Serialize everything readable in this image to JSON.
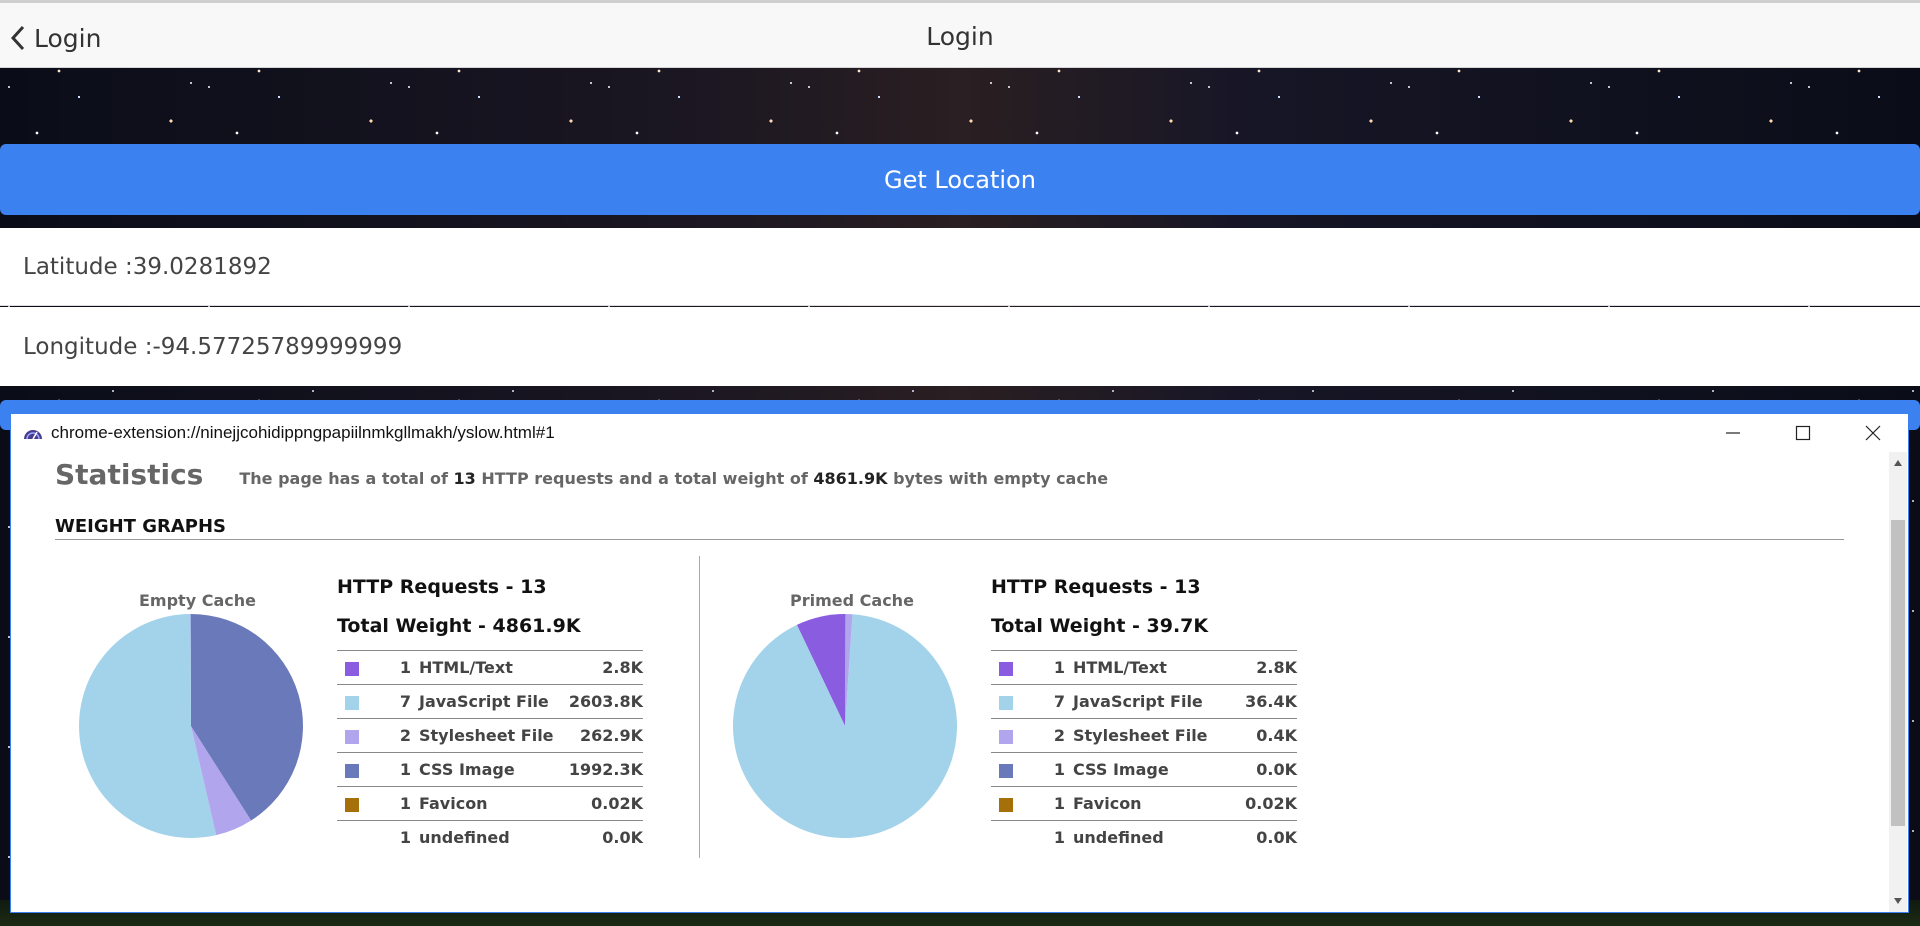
{
  "header": {
    "back_label": "Login",
    "title": "Login"
  },
  "location": {
    "button_label": "Get Location",
    "latitude": "Latitude :39.0281892",
    "longitude": "Longitude :-94.57725789999999"
  },
  "popup": {
    "url": "chrome-extension://ninejjcohidippngpapiilnmkgllmakh/yslow.html#1",
    "statistics": {
      "title": "Statistics",
      "text_1": "The page has a total of",
      "requests": "13",
      "text_2": "HTTP requests and a total weight of",
      "weight": "4861.9K",
      "text_3": "bytes with empty cache"
    },
    "weight_graphs_title": "WEIGHT GRAPHS",
    "empty_cache": {
      "caption": "Empty Cache",
      "requests_label": "HTTP Requests - 13",
      "weight_label": "Total Weight - 4861.9K",
      "rows": [
        {
          "count": "1",
          "label": "HTML/Text",
          "value": "2.8K",
          "color": "#8a5ce0"
        },
        {
          "count": "7",
          "label": "JavaScript File",
          "value": "2603.8K",
          "color": "#a3d3ea"
        },
        {
          "count": "2",
          "label": "Stylesheet File",
          "value": "262.9K",
          "color": "#b1a5ee"
        },
        {
          "count": "1",
          "label": "CSS Image",
          "value": "1992.3K",
          "color": "#6a79b9"
        },
        {
          "count": "1",
          "label": "Favicon",
          "value": "0.02K",
          "color": "#a56f0a"
        },
        {
          "count": "1",
          "label": "undefined",
          "value": "0.0K",
          "color": ""
        }
      ],
      "pie_values": [
        2.8,
        2603.8,
        262.9,
        1992.3,
        0.02
      ]
    },
    "primed_cache": {
      "caption": "Primed Cache",
      "requests_label": "HTTP Requests - 13",
      "weight_label": "Total Weight - 39.7K",
      "rows": [
        {
          "count": "1",
          "label": "HTML/Text",
          "value": "2.8K",
          "color": "#8a5ce0"
        },
        {
          "count": "7",
          "label": "JavaScript File",
          "value": "36.4K",
          "color": "#a3d3ea"
        },
        {
          "count": "2",
          "label": "Stylesheet File",
          "value": "0.4K",
          "color": "#b1a5ee"
        },
        {
          "count": "1",
          "label": "CSS Image",
          "value": "0.0K",
          "color": "#6a79b9"
        },
        {
          "count": "1",
          "label": "Favicon",
          "value": "0.02K",
          "color": "#a56f0a"
        },
        {
          "count": "1",
          "label": "undefined",
          "value": "0.0K",
          "color": ""
        }
      ],
      "pie_values": [
        2.8,
        36.4,
        0.4,
        0.0,
        0.02
      ]
    }
  }
}
